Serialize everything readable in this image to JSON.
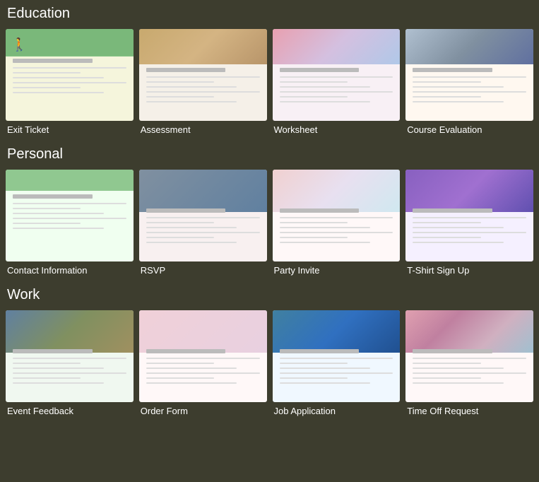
{
  "sections": [
    {
      "id": "education",
      "title": "Education",
      "templates": [
        {
          "id": "exit-ticket",
          "label": "Exit Ticket",
          "thumb_class": "thumb-exit-ticket"
        },
        {
          "id": "assessment",
          "label": "Assessment",
          "thumb_class": "thumb-assessment"
        },
        {
          "id": "worksheet",
          "label": "Worksheet",
          "thumb_class": "thumb-worksheet"
        },
        {
          "id": "course-evaluation",
          "label": "Course Evaluation",
          "thumb_class": "thumb-course-eval"
        }
      ]
    },
    {
      "id": "personal",
      "title": "Personal",
      "templates": [
        {
          "id": "contact-information",
          "label": "Contact Information",
          "thumb_class": "thumb-contact-info"
        },
        {
          "id": "rsvp",
          "label": "RSVP",
          "thumb_class": "thumb-rsvp"
        },
        {
          "id": "party-invite",
          "label": "Party Invite",
          "thumb_class": "thumb-party-invite"
        },
        {
          "id": "tshirt-sign-up",
          "label": "T-Shirt Sign Up",
          "thumb_class": "thumb-tshirt"
        }
      ]
    },
    {
      "id": "work",
      "title": "Work",
      "templates": [
        {
          "id": "event-feedback",
          "label": "Event Feedback",
          "thumb_class": "thumb-event-feedback"
        },
        {
          "id": "order-form",
          "label": "Order Form",
          "thumb_class": "thumb-order-form"
        },
        {
          "id": "job-application",
          "label": "Job Application",
          "thumb_class": "thumb-job-app"
        },
        {
          "id": "time-off-request",
          "label": "Time Off Request",
          "thumb_class": "thumb-time-off"
        }
      ]
    }
  ]
}
